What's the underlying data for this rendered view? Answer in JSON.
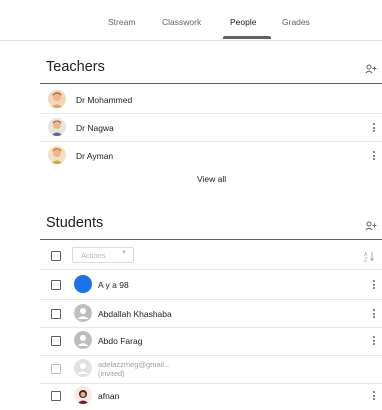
{
  "tabs": [
    {
      "label": "Stream",
      "active": false
    },
    {
      "label": "Classwork",
      "active": false
    },
    {
      "label": "People",
      "active": true
    },
    {
      "label": "Grades",
      "active": false
    }
  ],
  "teachers": {
    "title": "Teachers",
    "items": [
      {
        "name": "Dr Mohammed",
        "has_menu": false
      },
      {
        "name": "Dr Nagwa",
        "has_menu": true
      },
      {
        "name": "Dr Ayman",
        "has_menu": true
      }
    ],
    "view_all_label": "View all"
  },
  "students": {
    "title": "Students",
    "actions_label": "Actions",
    "items": [
      {
        "name": "A y a 98",
        "avatar": "blue-circle"
      },
      {
        "name": "Abdallah Khashaba",
        "avatar": "generic"
      },
      {
        "name": "Abdo Farag",
        "avatar": "generic"
      },
      {
        "name": "adelazzmeg@gmail...",
        "status": "(invited)",
        "avatar": "generic"
      },
      {
        "name": "afnan",
        "avatar": "photo"
      }
    ]
  },
  "icons": {
    "add_person": "add-person-icon",
    "sort": "sort-az-icon",
    "more": "more-vert-icon"
  },
  "colors": {
    "text": "#202124",
    "muted": "#5f6368",
    "avatar_blue": "#1a73e8"
  }
}
